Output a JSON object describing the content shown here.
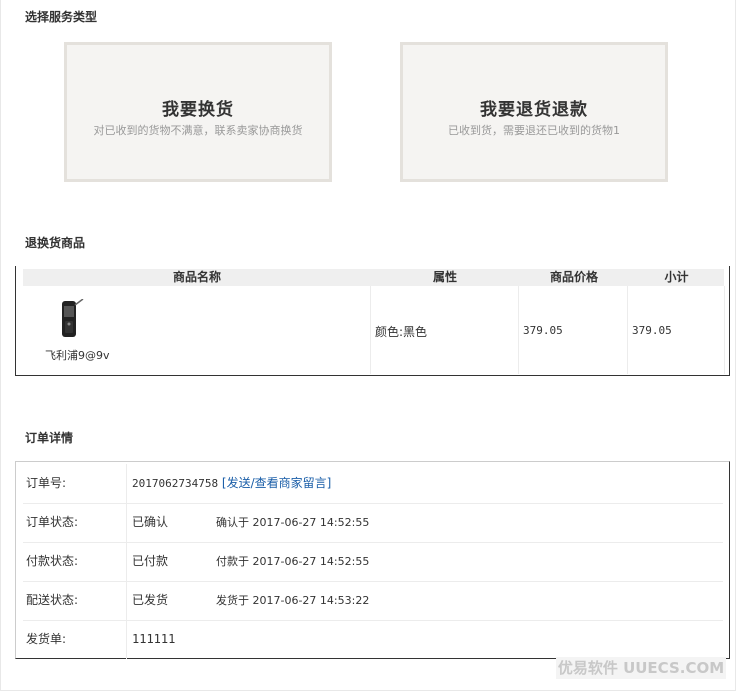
{
  "select_service": {
    "title": "选择服务类型",
    "exchange": {
      "title": "我要换货",
      "desc": "对已收到的货物不满意，联系卖家协商换货"
    },
    "refund": {
      "title": "我要退货退款",
      "desc": "已收到货，需要退还已收到的货物1"
    }
  },
  "goods": {
    "title": "退换货商品",
    "headers": [
      "商品名称",
      "属性",
      "商品价格",
      "小计"
    ],
    "item": {
      "name": "飞利浦9@9v",
      "attr": "颜色:黑色",
      "price": "379.05",
      "subtotal": "379.05"
    }
  },
  "order": {
    "title": "订单详情",
    "order_no_label": "订单号:",
    "order_no": "2017062734758",
    "message_link": "[发送/查看商家留言]",
    "order_status_label": "订单状态:",
    "order_status": "已确认",
    "order_status_time": "确认于 2017-06-27 14:52:55",
    "pay_status_label": "付款状态:",
    "pay_status": "已付款",
    "pay_status_time": "付款于 2017-06-27 14:52:55",
    "ship_status_label": "配送状态:",
    "ship_status": "已发货",
    "ship_status_time": "发货于 2017-06-27 14:53:22",
    "invoice_label": "发货单:",
    "invoice_no": "111111"
  },
  "watermark": "优易软件 UUECS.COM",
  "colors": {
    "link": "#1a5ea8",
    "card_bg": "#f5f4f2",
    "card_border": "#e4e1dc"
  }
}
